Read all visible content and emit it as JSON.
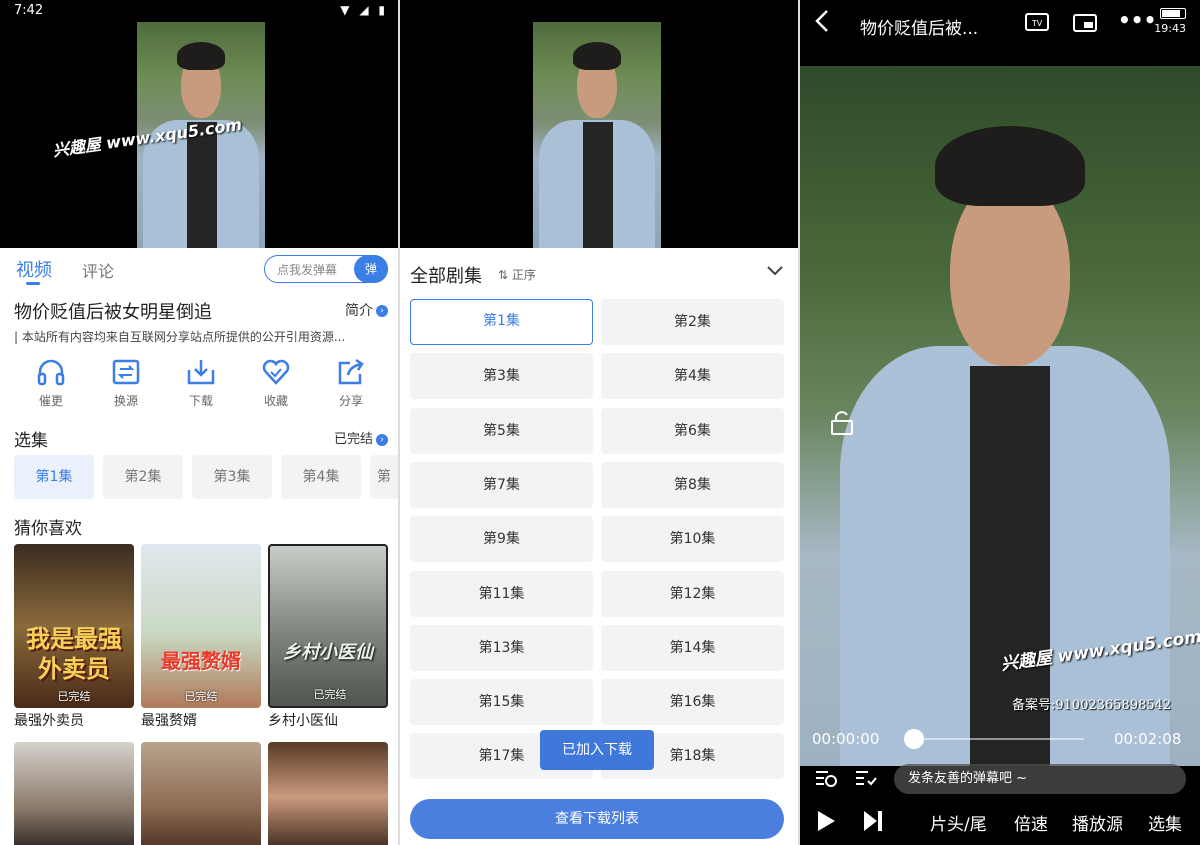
{
  "status_bar": {
    "time": "7:42",
    "icons": "▼ ◢ ▮"
  },
  "watermark": "兴趣屋 www.xqu5.com",
  "video": {
    "tabs": [
      "视频",
      "评论"
    ],
    "danmaku_placeholder": "点我发弹幕",
    "danmaku_button": "弹"
  },
  "detail": {
    "title": "物价贬值后被女明星倒追",
    "intro_label": "简介",
    "description": "| 本站所有内容均来自互联网分享站点所提供的公开引用资源...",
    "actions": [
      {
        "label": "催更",
        "icon": "headphones-icon"
      },
      {
        "label": "换源",
        "icon": "switch-source-icon"
      },
      {
        "label": "下载",
        "icon": "download-icon"
      },
      {
        "label": "收藏",
        "icon": "heart-icon"
      },
      {
        "label": "分享",
        "icon": "share-icon"
      }
    ],
    "episodes_title": "选集",
    "episodes_status": "已完结",
    "episodes": [
      "第1集",
      "第2集",
      "第3集",
      "第4集",
      "第"
    ],
    "recommend_title": "猜你喜欢",
    "recommend": [
      {
        "name": "最强外卖员",
        "badge": "已完结",
        "poster_text": "我是最强外卖员"
      },
      {
        "name": "最强赘婿",
        "badge": "已完结",
        "poster_text": "最强赘婿"
      },
      {
        "name": "乡村小医仙",
        "badge": "已完结",
        "poster_text": "乡村小医仙"
      }
    ]
  },
  "episode_list": {
    "title": "全部剧集",
    "sort": "正序",
    "episodes": [
      "第1集",
      "第2集",
      "第3集",
      "第4集",
      "第5集",
      "第6集",
      "第7集",
      "第8集",
      "第9集",
      "第10集",
      "第11集",
      "第12集",
      "第13集",
      "第14集",
      "第15集",
      "第16集",
      "第17集",
      "第18集"
    ],
    "toast": "已加入下载",
    "download_list_button": "查看下载列表"
  },
  "player": {
    "title": "物价贬值后被...",
    "clock": "19:43",
    "current_time": "00:00:00",
    "total_time": "00:02:08",
    "progress": 0,
    "filing_text": "备案号:91002365898542",
    "danmaku_placeholder": "发条友善的弹幕吧 ~",
    "buttons": [
      "片头/尾",
      "倍速",
      "播放源",
      "选集"
    ],
    "top_icons": [
      "TV",
      "画中画",
      "•••"
    ]
  },
  "colors": {
    "accent": "#3a7ee6",
    "chip_bg": "#f2f3f5"
  }
}
